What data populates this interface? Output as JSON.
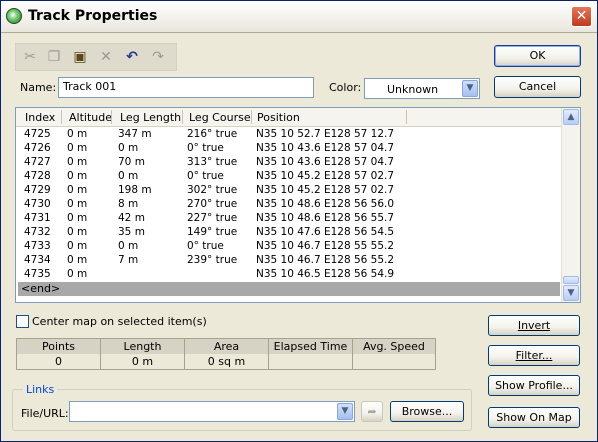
{
  "window": {
    "title": "Track Properties",
    "close_glyph": "✕",
    "app_icon": "globe-icon"
  },
  "toolbar": {
    "icons": [
      "cut-icon",
      "copy-icon",
      "paste-icon",
      "delete-icon",
      "undo-icon",
      "redo-icon"
    ],
    "glyphs": {
      "cut": "✂",
      "copy": "❐",
      "paste": "▣",
      "delete": "✕",
      "undo": "↶",
      "redo": "↷"
    }
  },
  "buttons": {
    "ok": "OK",
    "cancel": "Cancel",
    "invert": "Invert",
    "filter": "Filter...",
    "show_profile": "Show Profile...",
    "show_on_map": "Show On Map",
    "browse": "Browse...",
    "go_glyph": "➦"
  },
  "name_field": {
    "label": "Name:",
    "value": "Track 001"
  },
  "color_field": {
    "label": "Color:",
    "value": "Unknown"
  },
  "dropdown_glyph": "▼",
  "table": {
    "headers": [
      "Index",
      "Altitude",
      "Leg Length",
      "Leg Course",
      "Position"
    ],
    "rows": [
      [
        "4725",
        "0 m",
        "347 m",
        "216° true",
        "N35 10 52.7 E128 57 12.7"
      ],
      [
        "4726",
        "0 m",
        "0 m",
        "0° true",
        "N35 10 43.6 E128 57 04.7"
      ],
      [
        "4727",
        "0 m",
        "70 m",
        "313° true",
        "N35 10 43.6 E128 57 04.7"
      ],
      [
        "4728",
        "0 m",
        "0 m",
        "0° true",
        "N35 10 45.2 E128 57 02.7"
      ],
      [
        "4729",
        "0 m",
        "198 m",
        "302° true",
        "N35 10 45.2 E128 57 02.7"
      ],
      [
        "4730",
        "0 m",
        "8 m",
        "270° true",
        "N35 10 48.6 E128 56 56.0"
      ],
      [
        "4731",
        "0 m",
        "42 m",
        "227° true",
        "N35 10 48.6 E128 56 55.7"
      ],
      [
        "4732",
        "0 m",
        "35 m",
        "149° true",
        "N35 10 47.6 E128 56 54.5"
      ],
      [
        "4733",
        "0 m",
        "0 m",
        "0° true",
        "N35 10 46.7 E128 55 55.2"
      ],
      [
        "4734",
        "0 m",
        "7 m",
        "239° true",
        "N35 10 46.7 E128 56 55.2"
      ],
      [
        "4735",
        "0 m",
        "",
        "",
        "N35 10 46.5 E128 56 54.9"
      ]
    ],
    "end_label": "<end>"
  },
  "scroll": {
    "up_glyph": "▲",
    "down_glyph": "▼"
  },
  "center_map": {
    "label": "Center map on selected item(s)",
    "checked": false
  },
  "stats": {
    "headers": [
      "Points",
      "Length",
      "Area",
      "Elapsed Time",
      "Avg. Speed"
    ],
    "values": [
      "0",
      "0 m",
      "0 sq m",
      "",
      ""
    ]
  },
  "links": {
    "legend": "Links",
    "label": "File/URL:",
    "value": ""
  }
}
